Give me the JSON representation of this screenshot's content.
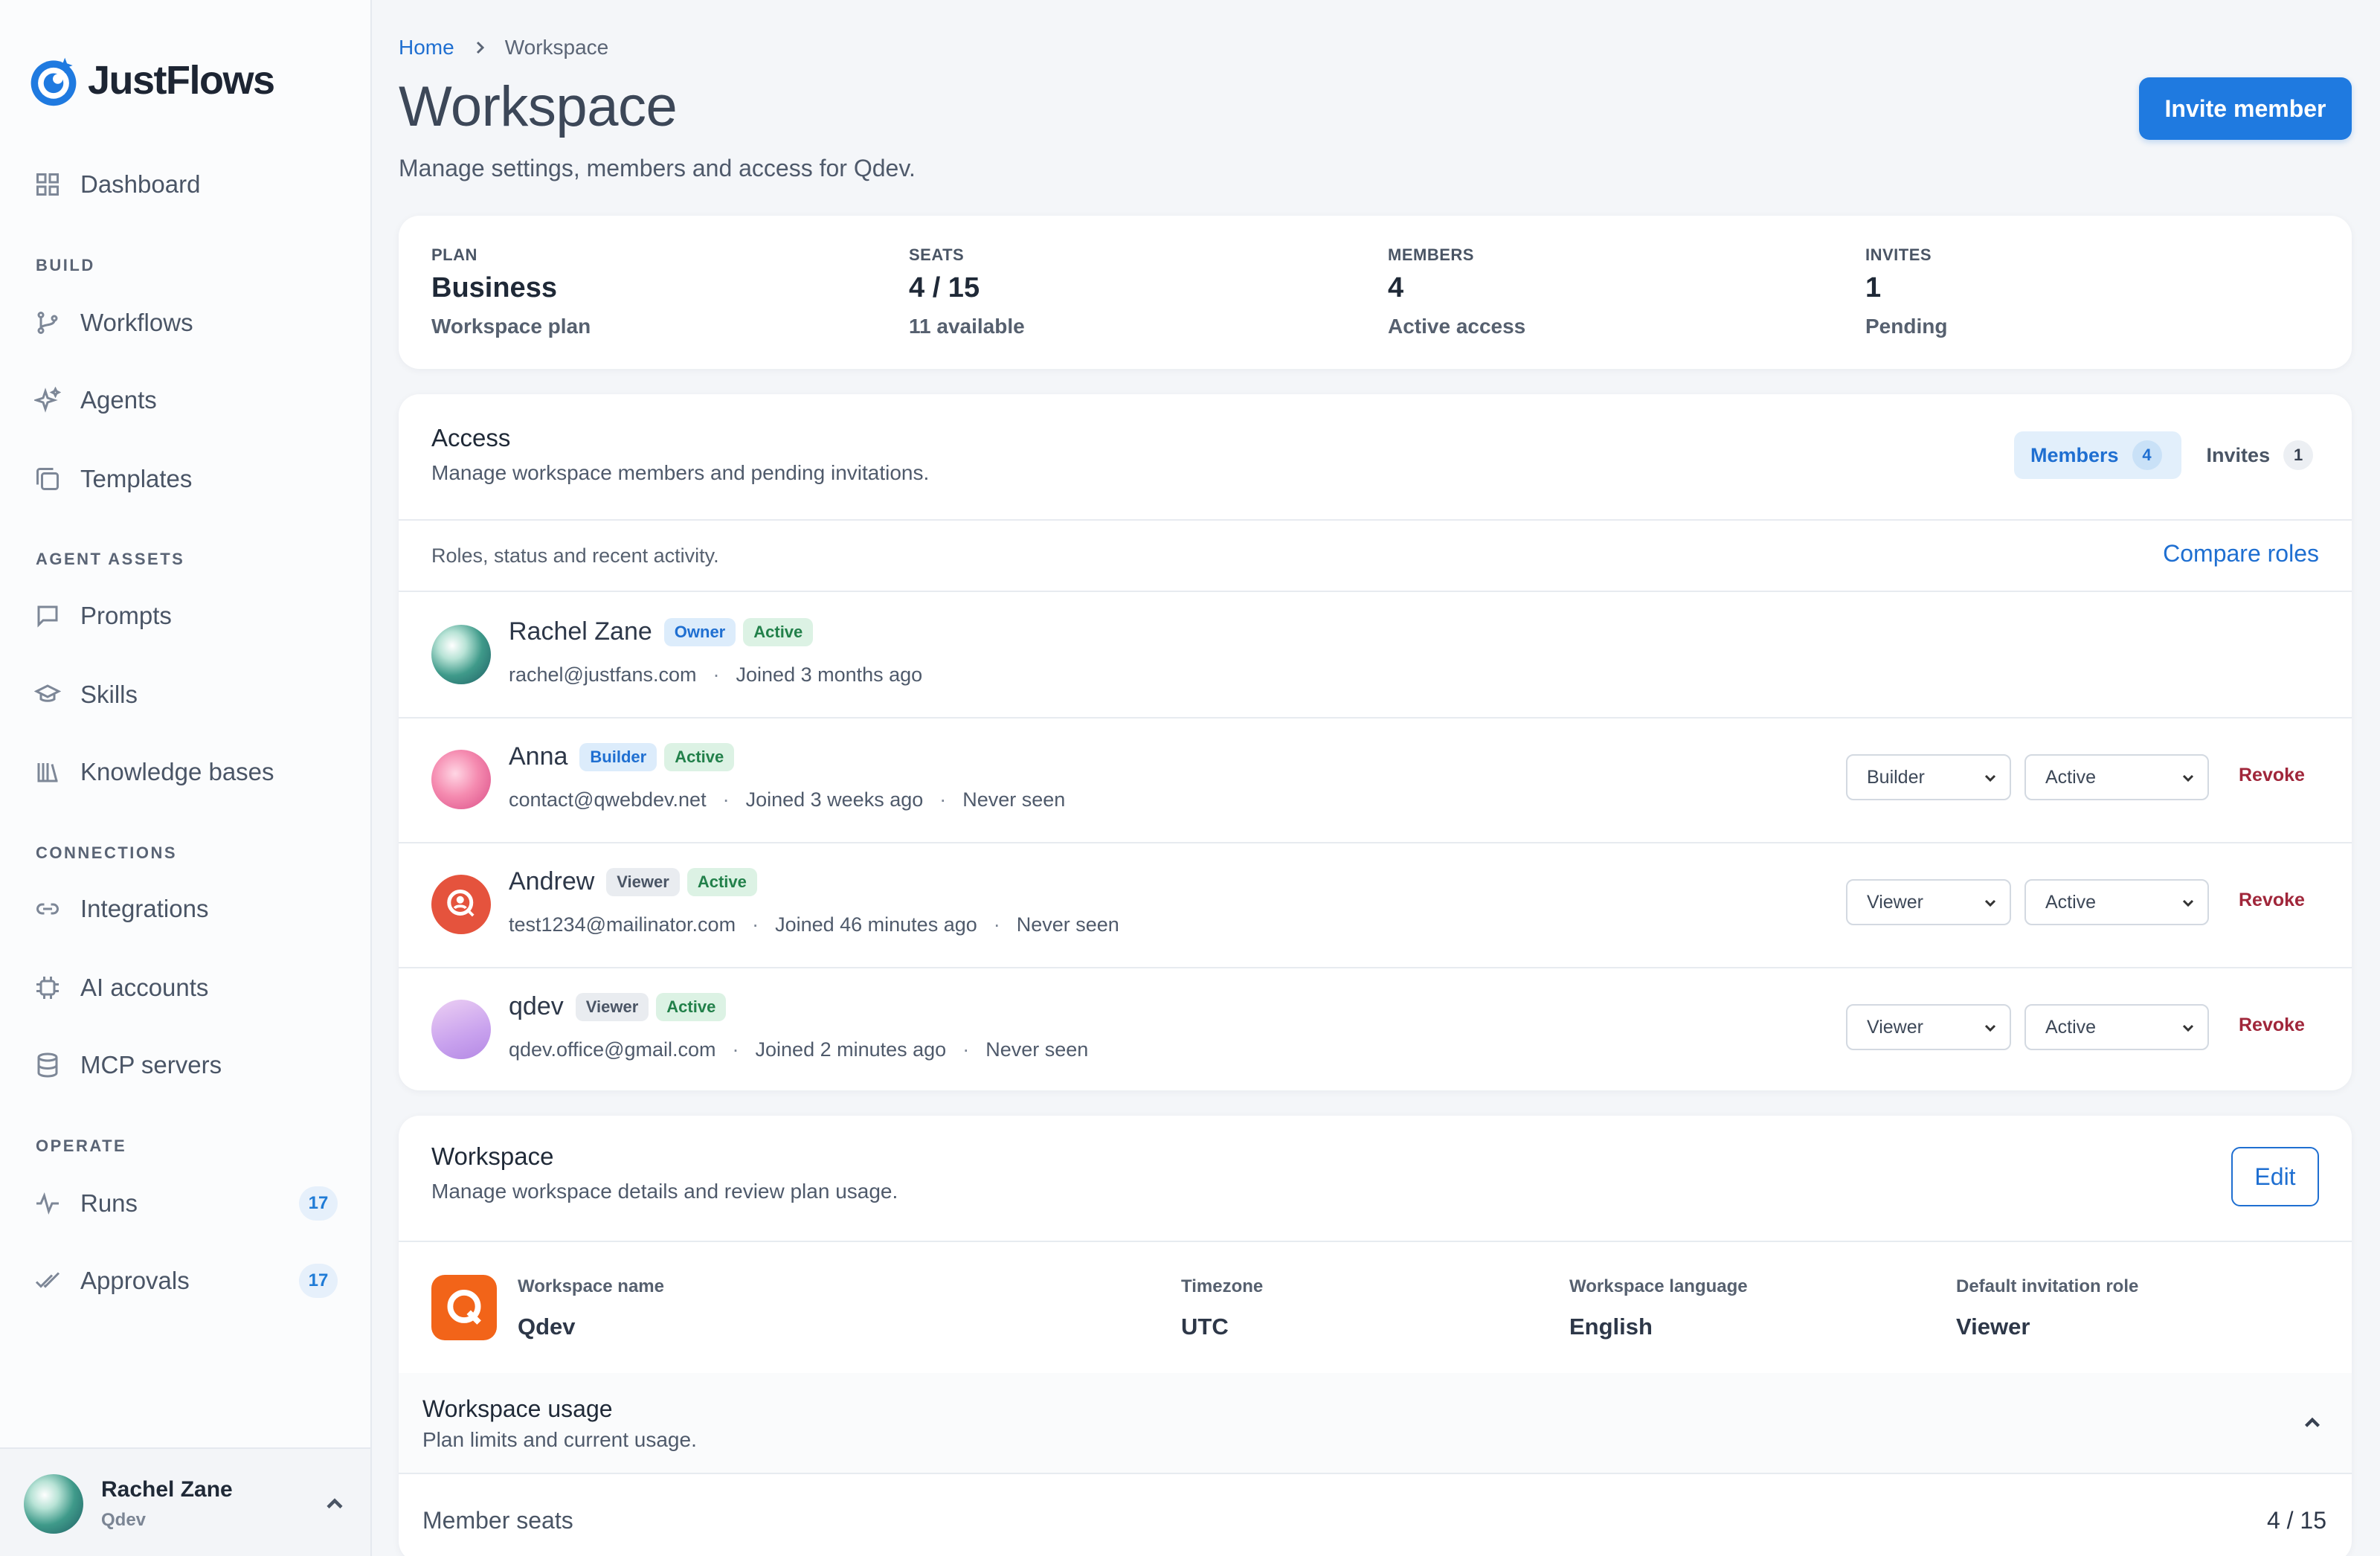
{
  "app": {
    "name": "JustFlows"
  },
  "sidebar": {
    "dashboard": "Dashboard",
    "sections": {
      "build": "BUILD",
      "agent_assets": "AGENT ASSETS",
      "connections": "CONNECTIONS",
      "operate": "OPERATE"
    },
    "items": {
      "workflows": "Workflows",
      "agents": "Agents",
      "templates": "Templates",
      "prompts": "Prompts",
      "skills": "Skills",
      "knowledge_bases": "Knowledge bases",
      "integrations": "Integrations",
      "ai_accounts": "AI accounts",
      "mcp_servers": "MCP servers",
      "runs": "Runs",
      "approvals": "Approvals"
    },
    "badges": {
      "runs": "17",
      "approvals": "17"
    },
    "user": {
      "name": "Rachel Zane",
      "org": "Qdev"
    }
  },
  "header": {
    "breadcrumb": {
      "home": "Home",
      "current": "Workspace"
    },
    "title": "Workspace",
    "subtitle": "Manage settings, members and access for Qdev.",
    "invite_label": "Invite member"
  },
  "stats": [
    {
      "label": "PLAN",
      "value": "Business",
      "note": "Workspace plan"
    },
    {
      "label": "SEATS",
      "value": "4 / 15",
      "note": "11 available"
    },
    {
      "label": "MEMBERS",
      "value": "4",
      "note": "Active access"
    },
    {
      "label": "INVITES",
      "value": "1",
      "note": "Pending"
    }
  ],
  "access": {
    "title": "Access",
    "description": "Manage workspace members and pending invitations.",
    "tabs": {
      "members": {
        "label": "Members",
        "count": "4"
      },
      "invites": {
        "label": "Invites",
        "count": "1"
      }
    },
    "note": "Roles, status and recent activity.",
    "compare_label": "Compare roles",
    "revoke_label": "Revoke",
    "members": [
      {
        "name": "Rachel Zane",
        "role": "Owner",
        "status": "Active",
        "email": "rachel@justfans.com",
        "joined": "Joined 3 months ago",
        "seen": ""
      },
      {
        "name": "Anna",
        "role": "Builder",
        "status": "Active",
        "email": "contact@qwebdev.net",
        "joined": "Joined 3 weeks ago",
        "seen": "Never seen"
      },
      {
        "name": "Andrew",
        "role": "Viewer",
        "status": "Active",
        "email": "test1234@mailinator.com",
        "joined": "Joined 46 minutes ago",
        "seen": "Never seen"
      },
      {
        "name": "qdev",
        "role": "Viewer",
        "status": "Active",
        "email": "qdev.office@gmail.com",
        "joined": "Joined 2 minutes ago",
        "seen": "Never seen"
      }
    ]
  },
  "workspace": {
    "title": "Workspace",
    "description": "Manage workspace details and review plan usage.",
    "edit_label": "Edit",
    "fields": {
      "name": {
        "label": "Workspace name",
        "value": "Qdev"
      },
      "timezone": {
        "label": "Timezone",
        "value": "UTC"
      },
      "language": {
        "label": "Workspace language",
        "value": "English"
      },
      "default_role": {
        "label": "Default invitation role",
        "value": "Viewer"
      }
    },
    "usage": {
      "title": "Workspace usage",
      "description": "Plan limits and current usage.",
      "seats_label": "Member seats",
      "seats_value": "4 / 15"
    }
  },
  "colors": {
    "accent": "#1f7ae0",
    "revoke": "#a0263a",
    "active_green": "#22804a",
    "workspace_logo": "#f26419"
  }
}
